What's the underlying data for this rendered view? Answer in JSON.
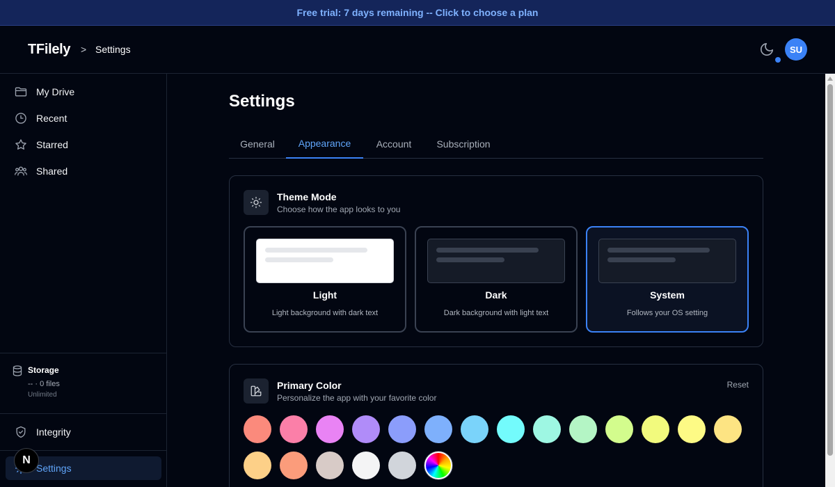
{
  "banner": {
    "text": "Free trial: 7 days remaining -- Click to choose a plan"
  },
  "header": {
    "brand": "TFilely",
    "separator": ">",
    "page": "Settings",
    "avatar_initials": "SU"
  },
  "sidebar": {
    "items": [
      {
        "label": "My Drive",
        "icon": "folder-icon"
      },
      {
        "label": "Recent",
        "icon": "clock-icon"
      },
      {
        "label": "Starred",
        "icon": "star-icon"
      },
      {
        "label": "Shared",
        "icon": "users-icon"
      }
    ],
    "storage": {
      "title": "Storage",
      "files": "-- · 0 files",
      "limit": "Unlimited"
    },
    "integrity": "Integrity",
    "settings": "Settings",
    "next_badge": "N"
  },
  "main": {
    "title": "Settings",
    "tabs": [
      "General",
      "Appearance",
      "Account",
      "Subscription"
    ],
    "active_tab": "Appearance",
    "theme": {
      "title": "Theme Mode",
      "subtitle": "Choose how the app looks to you",
      "options": [
        {
          "name": "Light",
          "desc": "Light background with dark text"
        },
        {
          "name": "Dark",
          "desc": "Dark background with light text"
        },
        {
          "name": "System",
          "desc": "Follows your OS setting"
        }
      ],
      "selected": "System"
    },
    "color": {
      "title": "Primary Color",
      "subtitle": "Personalize the app with your favorite color",
      "reset": "Reset",
      "swatches": [
        "#fb8a7c",
        "#fb7fa8",
        "#e983f4",
        "#b08cf9",
        "#8b9dfb",
        "#7eb0fc",
        "#7ad3fa",
        "#73fbfc",
        "#9ef7e3",
        "#b4f5c5",
        "#d3fc8d",
        "#f2fa7d",
        "#fdfa85",
        "#fde483",
        "#fdd088",
        "#fb9c7b",
        "#d8cbc7",
        "#f4f4f5",
        "#d1d5db",
        "rainbow"
      ]
    }
  }
}
